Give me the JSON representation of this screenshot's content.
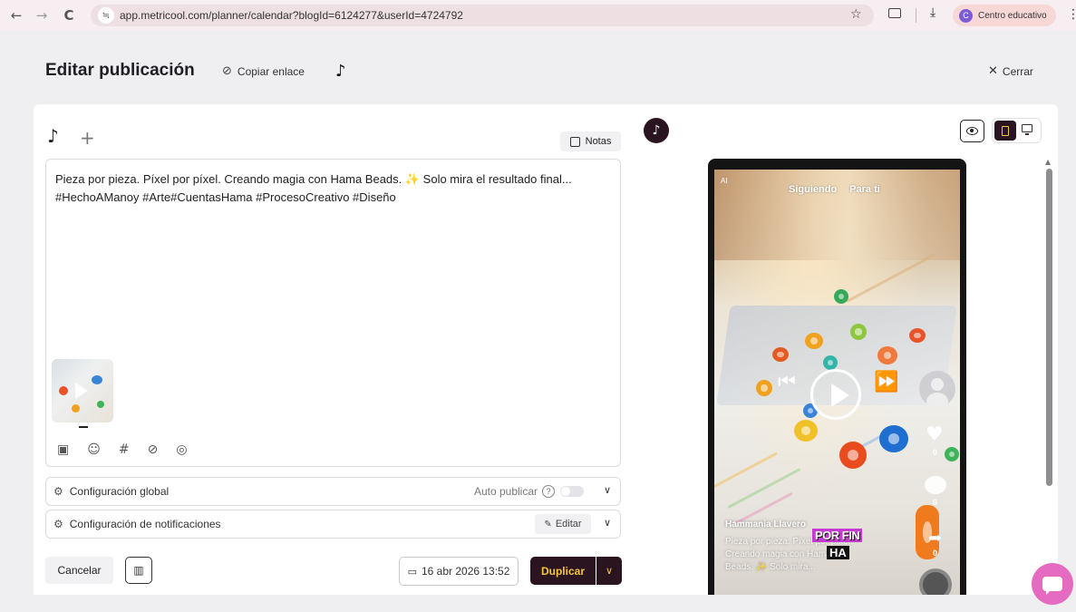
{
  "browser": {
    "back": "←",
    "forward": "→",
    "reload": "C",
    "url_icon": "≒",
    "url": "app.metricool.com/planner/calendar?blogId=6124277&userId=4724792",
    "profile_initial": "C",
    "profile_name": "Centro educativo"
  },
  "header": {
    "title": "Editar publicación",
    "copy_link": "Copiar enlace",
    "close": "Cerrar"
  },
  "editor": {
    "notes_label": "Notas",
    "post_text_line1": "Pieza por pieza. Píxel por píxel. Creando magia con Hama Beads. ✨ Solo mira el resultado final...",
    "post_text_line2": "#HechoAManoy #Arte#CuentasHama #ProcesoCreativo #Diseño"
  },
  "config": {
    "global_label": "Configuración global",
    "auto_publish_label": "Auto publicar",
    "auto_publish_on": false,
    "notifications_label": "Configuración de notificaciones",
    "edit_label": "Editar"
  },
  "footer": {
    "cancel_label": "Cancelar",
    "date_label": "16 abr 2026 13:52",
    "duplicate_label": "Duplicar"
  },
  "preview": {
    "device_selected": "mobile",
    "ai_badge": "AI",
    "following_tab": "Siguiendo",
    "for_you_tab": "Para ti",
    "likes": "0",
    "comments": "0",
    "shares": "0",
    "username": "Hammania Llavero",
    "caption": "Pieza por pieza. Píxel por píxel. Creando magia con Hama Beads. ✨ Solo mira...",
    "overlay_line1": "POR FIN",
    "overlay_line2": "HA"
  },
  "colors": {
    "brand_dark": "#2a1420",
    "brand_yellow": "#f5c63a",
    "chat_pink": "#e56bc1"
  }
}
